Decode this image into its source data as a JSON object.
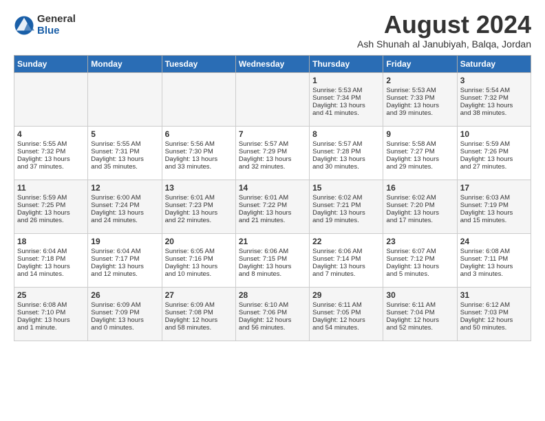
{
  "logo": {
    "general": "General",
    "blue": "Blue"
  },
  "title": "August 2024",
  "subtitle": "Ash Shunah al Janubiyah, Balqa, Jordan",
  "days_of_week": [
    "Sunday",
    "Monday",
    "Tuesday",
    "Wednesday",
    "Thursday",
    "Friday",
    "Saturday"
  ],
  "weeks": [
    [
      {
        "day": "",
        "info": ""
      },
      {
        "day": "",
        "info": ""
      },
      {
        "day": "",
        "info": ""
      },
      {
        "day": "",
        "info": ""
      },
      {
        "day": "1",
        "info": "Sunrise: 5:53 AM\nSunset: 7:34 PM\nDaylight: 13 hours\nand 41 minutes."
      },
      {
        "day": "2",
        "info": "Sunrise: 5:53 AM\nSunset: 7:33 PM\nDaylight: 13 hours\nand 39 minutes."
      },
      {
        "day": "3",
        "info": "Sunrise: 5:54 AM\nSunset: 7:32 PM\nDaylight: 13 hours\nand 38 minutes."
      }
    ],
    [
      {
        "day": "4",
        "info": "Sunrise: 5:55 AM\nSunset: 7:32 PM\nDaylight: 13 hours\nand 37 minutes."
      },
      {
        "day": "5",
        "info": "Sunrise: 5:55 AM\nSunset: 7:31 PM\nDaylight: 13 hours\nand 35 minutes."
      },
      {
        "day": "6",
        "info": "Sunrise: 5:56 AM\nSunset: 7:30 PM\nDaylight: 13 hours\nand 33 minutes."
      },
      {
        "day": "7",
        "info": "Sunrise: 5:57 AM\nSunset: 7:29 PM\nDaylight: 13 hours\nand 32 minutes."
      },
      {
        "day": "8",
        "info": "Sunrise: 5:57 AM\nSunset: 7:28 PM\nDaylight: 13 hours\nand 30 minutes."
      },
      {
        "day": "9",
        "info": "Sunrise: 5:58 AM\nSunset: 7:27 PM\nDaylight: 13 hours\nand 29 minutes."
      },
      {
        "day": "10",
        "info": "Sunrise: 5:59 AM\nSunset: 7:26 PM\nDaylight: 13 hours\nand 27 minutes."
      }
    ],
    [
      {
        "day": "11",
        "info": "Sunrise: 5:59 AM\nSunset: 7:25 PM\nDaylight: 13 hours\nand 26 minutes."
      },
      {
        "day": "12",
        "info": "Sunrise: 6:00 AM\nSunset: 7:24 PM\nDaylight: 13 hours\nand 24 minutes."
      },
      {
        "day": "13",
        "info": "Sunrise: 6:01 AM\nSunset: 7:23 PM\nDaylight: 13 hours\nand 22 minutes."
      },
      {
        "day": "14",
        "info": "Sunrise: 6:01 AM\nSunset: 7:22 PM\nDaylight: 13 hours\nand 21 minutes."
      },
      {
        "day": "15",
        "info": "Sunrise: 6:02 AM\nSunset: 7:21 PM\nDaylight: 13 hours\nand 19 minutes."
      },
      {
        "day": "16",
        "info": "Sunrise: 6:02 AM\nSunset: 7:20 PM\nDaylight: 13 hours\nand 17 minutes."
      },
      {
        "day": "17",
        "info": "Sunrise: 6:03 AM\nSunset: 7:19 PM\nDaylight: 13 hours\nand 15 minutes."
      }
    ],
    [
      {
        "day": "18",
        "info": "Sunrise: 6:04 AM\nSunset: 7:18 PM\nDaylight: 13 hours\nand 14 minutes."
      },
      {
        "day": "19",
        "info": "Sunrise: 6:04 AM\nSunset: 7:17 PM\nDaylight: 13 hours\nand 12 minutes."
      },
      {
        "day": "20",
        "info": "Sunrise: 6:05 AM\nSunset: 7:16 PM\nDaylight: 13 hours\nand 10 minutes."
      },
      {
        "day": "21",
        "info": "Sunrise: 6:06 AM\nSunset: 7:15 PM\nDaylight: 13 hours\nand 8 minutes."
      },
      {
        "day": "22",
        "info": "Sunrise: 6:06 AM\nSunset: 7:14 PM\nDaylight: 13 hours\nand 7 minutes."
      },
      {
        "day": "23",
        "info": "Sunrise: 6:07 AM\nSunset: 7:12 PM\nDaylight: 13 hours\nand 5 minutes."
      },
      {
        "day": "24",
        "info": "Sunrise: 6:08 AM\nSunset: 7:11 PM\nDaylight: 13 hours\nand 3 minutes."
      }
    ],
    [
      {
        "day": "25",
        "info": "Sunrise: 6:08 AM\nSunset: 7:10 PM\nDaylight: 13 hours\nand 1 minute."
      },
      {
        "day": "26",
        "info": "Sunrise: 6:09 AM\nSunset: 7:09 PM\nDaylight: 13 hours\nand 0 minutes."
      },
      {
        "day": "27",
        "info": "Sunrise: 6:09 AM\nSunset: 7:08 PM\nDaylight: 12 hours\nand 58 minutes."
      },
      {
        "day": "28",
        "info": "Sunrise: 6:10 AM\nSunset: 7:06 PM\nDaylight: 12 hours\nand 56 minutes."
      },
      {
        "day": "29",
        "info": "Sunrise: 6:11 AM\nSunset: 7:05 PM\nDaylight: 12 hours\nand 54 minutes."
      },
      {
        "day": "30",
        "info": "Sunrise: 6:11 AM\nSunset: 7:04 PM\nDaylight: 12 hours\nand 52 minutes."
      },
      {
        "day": "31",
        "info": "Sunrise: 6:12 AM\nSunset: 7:03 PM\nDaylight: 12 hours\nand 50 minutes."
      }
    ]
  ]
}
